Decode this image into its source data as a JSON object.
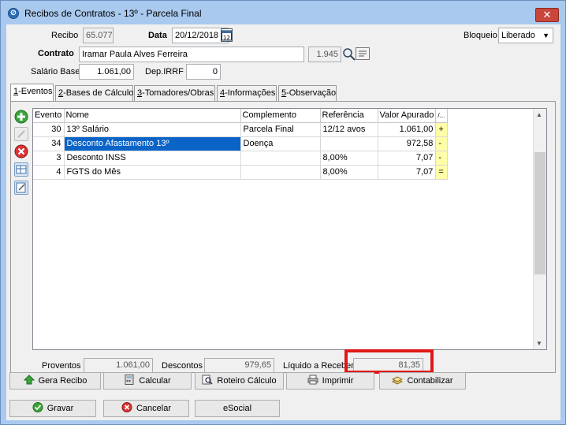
{
  "window": {
    "title": "Recibos de Contratos - 13º - Parcela Final",
    "close_glyph": "✕"
  },
  "header": {
    "recibo_label": "Recibo",
    "recibo_value": "65.077",
    "data_label": "Data",
    "data_value": "20/12/2018",
    "bloqueio_label": "Bloqueio",
    "bloqueio_value": "Liberado",
    "contrato_label": "Contrato",
    "contrato_value": "Iramar Paula Alves Ferreira",
    "contrato_code": "1.945",
    "salario_label": "Salário Base",
    "salario_value": "1.061,00",
    "dep_label": "Dep.IRRF",
    "dep_value": "0"
  },
  "tabs": [
    {
      "key": "1",
      "label": "-Eventos"
    },
    {
      "key": "2",
      "label": "-Bases de Cálculo"
    },
    {
      "key": "3",
      "label": "-Tomadores/Obras"
    },
    {
      "key": "4",
      "label": "-Informações"
    },
    {
      "key": "5",
      "label": "-Observação"
    }
  ],
  "grid": {
    "columns": [
      "Evento",
      "Nome",
      "Complemento",
      "Referência",
      "Valor Apurado",
      "/..."
    ],
    "rows": [
      {
        "evento": "30",
        "nome": "13º Salário",
        "complemento": "Parcela Final",
        "referencia": "12/12 avos",
        "valor": "1.061,00",
        "sinal": "+"
      },
      {
        "evento": "34",
        "nome": "Desconto Afastamento 13º",
        "complemento": "Doença",
        "referencia": "",
        "valor": "972,58",
        "sinal": "-"
      },
      {
        "evento": "3",
        "nome": "Desconto INSS",
        "complemento": "",
        "referencia": "8,00%",
        "valor": "7,07",
        "sinal": "-"
      },
      {
        "evento": "4",
        "nome": "FGTS do Mês",
        "complemento": "",
        "referencia": "8,00%",
        "valor": "7,07",
        "sinal": "="
      }
    ]
  },
  "totals": {
    "proventos_label": "Proventos",
    "proventos_value": "1.061,00",
    "descontos_label": "Descontos",
    "descontos_value": "979,65",
    "liquido_label": "Líquido a Receber",
    "liquido_value": "81,35"
  },
  "buttons": {
    "gera_recibo": "Gera Recibo",
    "calcular": "Calcular",
    "roteiro": "Roteiro Cálculo",
    "imprimir": "Imprimir",
    "contabilizar": "Contabilizar",
    "gravar": "Gravar",
    "cancelar": "Cancelar",
    "esocial": "eSocial"
  },
  "colors": {
    "title_bg": "#a9c9ee",
    "close": "#c9463d",
    "selection": "#0a64c8",
    "sign_cell": "#ffffa8",
    "highlight_box": "#e01818"
  }
}
